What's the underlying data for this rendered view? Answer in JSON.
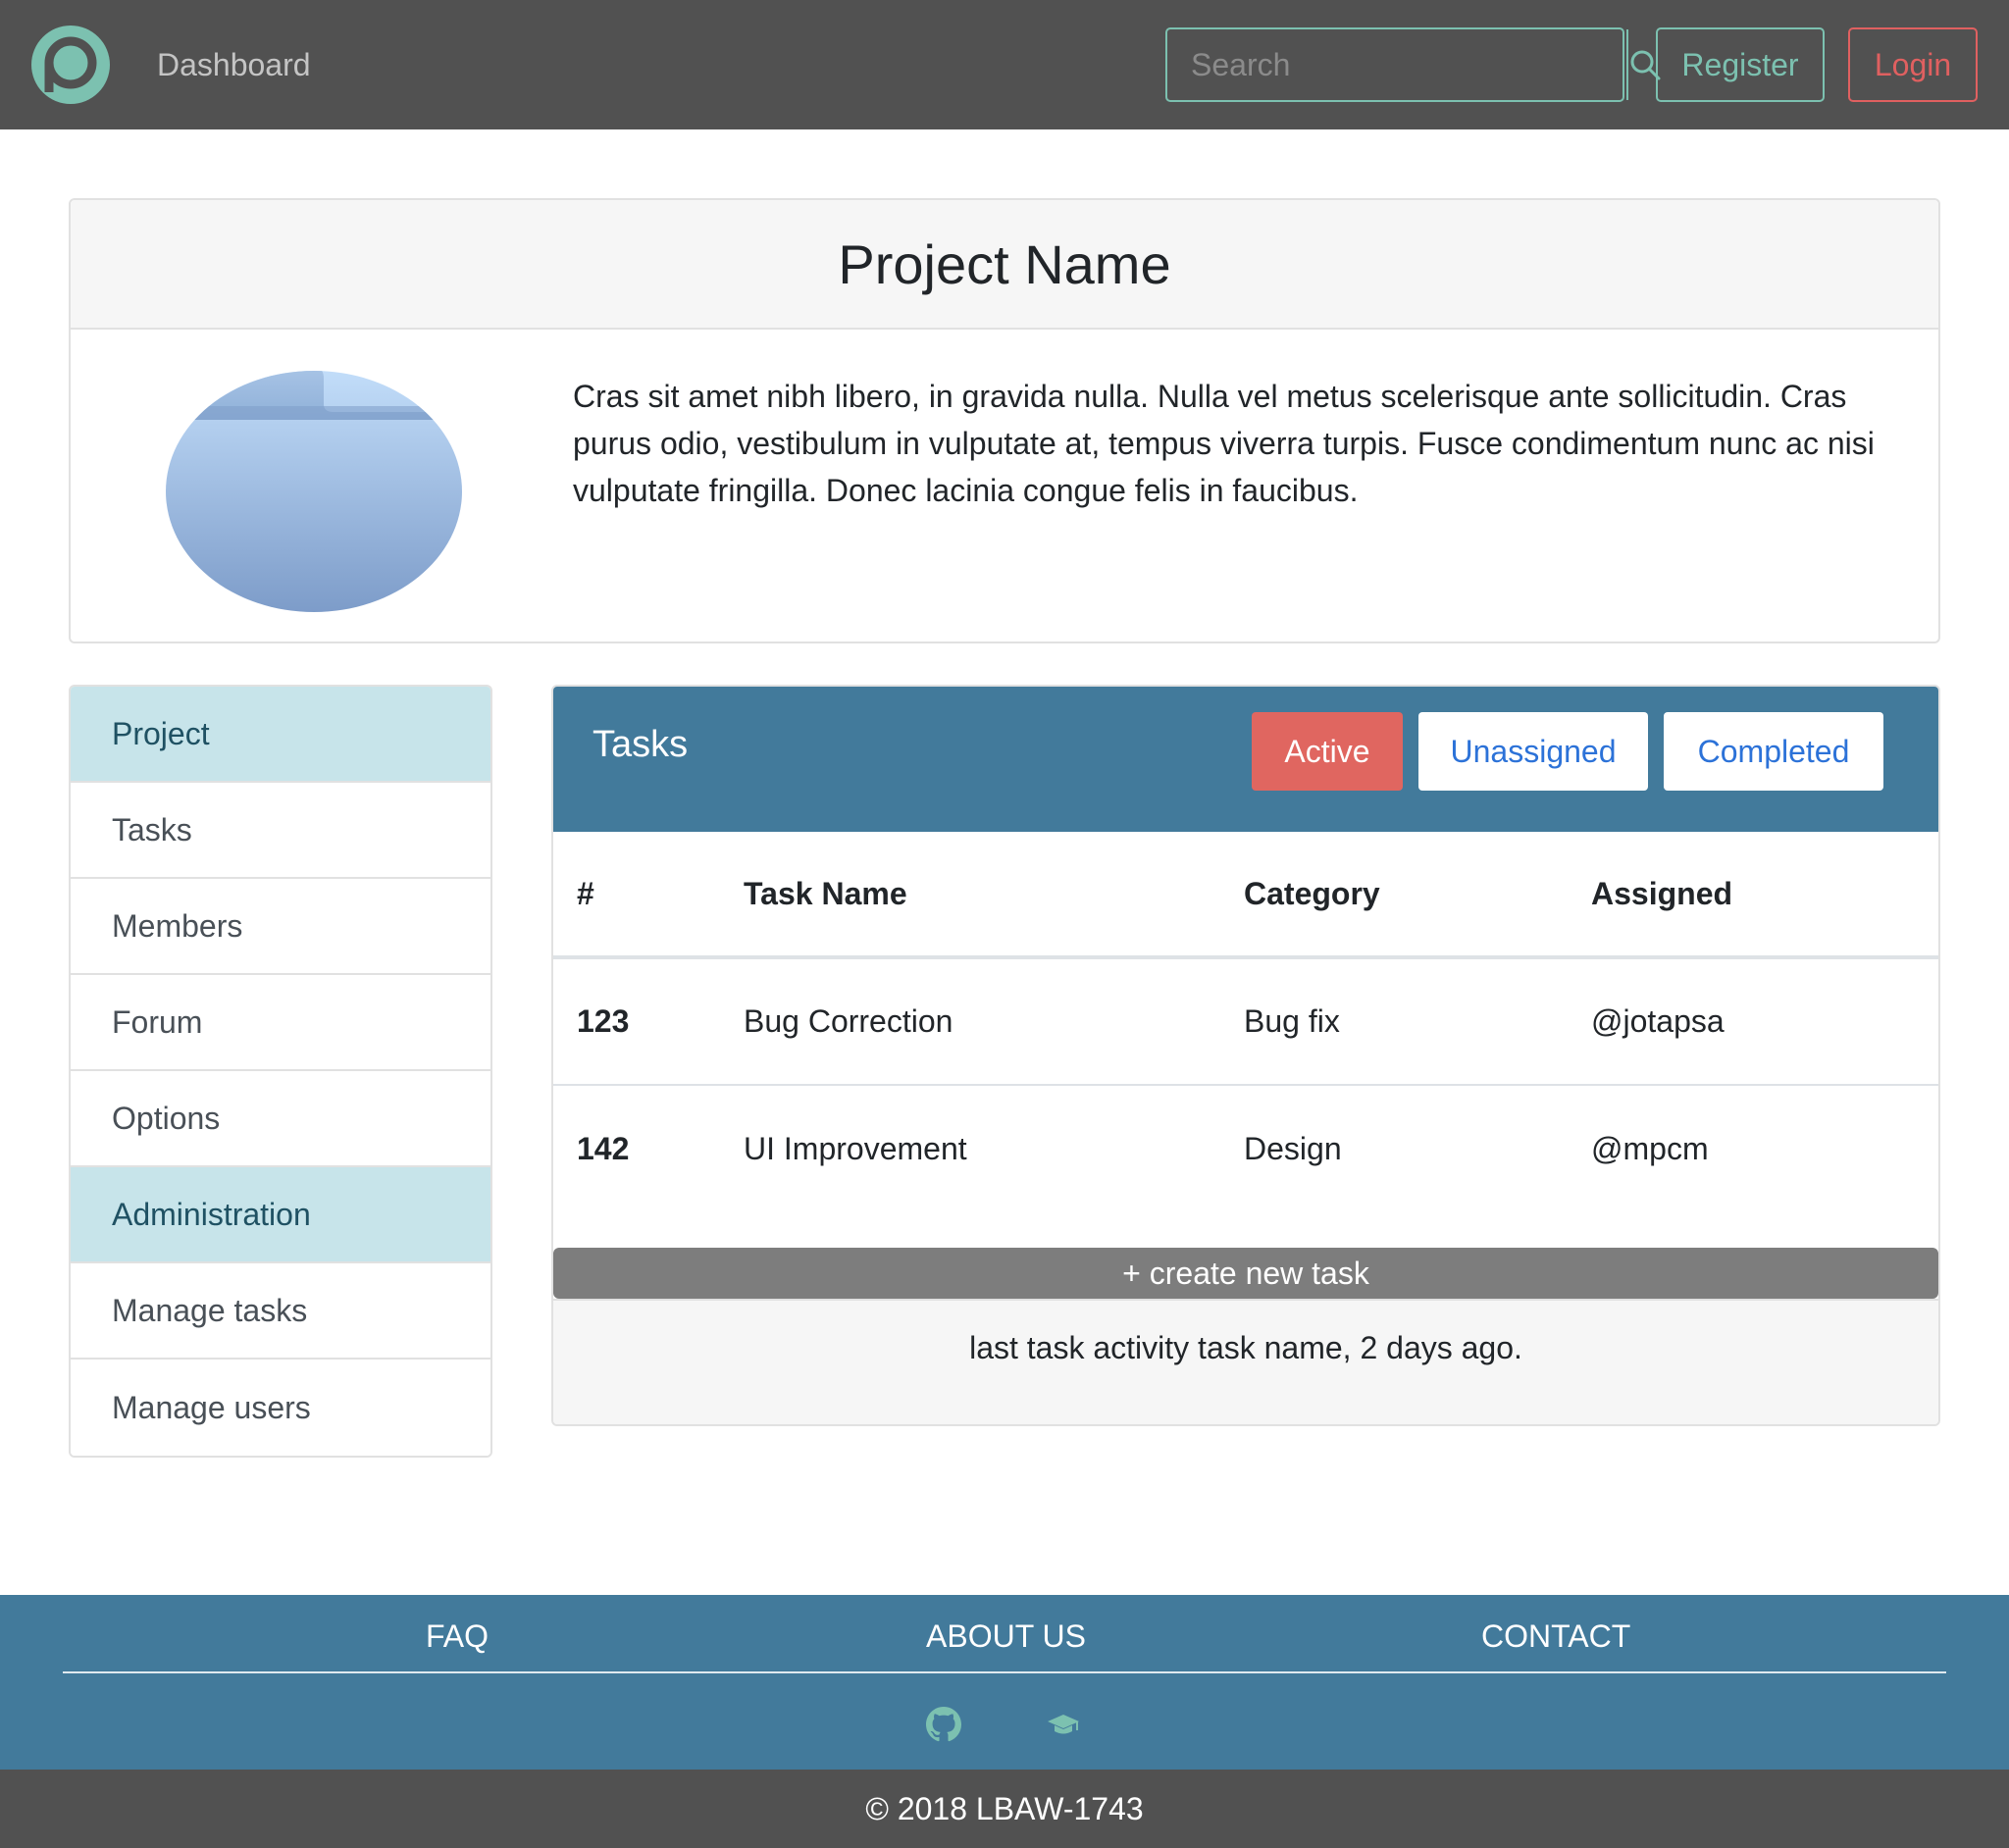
{
  "navbar": {
    "logo_icon": "logo-icon",
    "dashboard_label": "Dashboard",
    "search_placeholder": "Search",
    "search_icon": "search-icon",
    "register_label": "Register",
    "login_label": "Login"
  },
  "project": {
    "title": "Project Name",
    "image_icon": "folder-icon",
    "description": "Cras sit amet nibh libero, in gravida nulla. Nulla vel metus scelerisque ante sollicitudin. Cras purus odio, vestibulum in vulputate at, tempus viverra turpis. Fusce condimentum nunc ac nisi vulputate fringilla. Donec lacinia congue felis in faucibus."
  },
  "sidebar": {
    "items": [
      {
        "label": "Project"
      },
      {
        "label": "Tasks"
      },
      {
        "label": "Members"
      },
      {
        "label": "Forum"
      },
      {
        "label": "Options"
      },
      {
        "label": "Administration"
      },
      {
        "label": "Manage tasks"
      },
      {
        "label": "Manage users"
      }
    ]
  },
  "tasks": {
    "title": "Tasks",
    "filters": {
      "active": "Active",
      "unassigned": "Unassigned",
      "completed": "Completed"
    },
    "columns": [
      "#",
      "Task Name",
      "Category",
      "Assigned"
    ],
    "rows": [
      {
        "num": "123",
        "name": "Bug Correction",
        "category": "Bug fix",
        "assigned": "@jotapsa"
      },
      {
        "num": "142",
        "name": "UI Improvement",
        "category": "Design",
        "assigned": "@mpcm"
      }
    ],
    "create_label": "+ create new task",
    "last_activity": "last task activity task name, 2 days ago."
  },
  "footer": {
    "links": {
      "faq": "FAQ",
      "about": "ABOUT US",
      "contact": "CONTACT"
    },
    "icons": [
      "github-icon",
      "graduation-cap-icon"
    ],
    "copyright": "© 2018 LBAW-1743"
  },
  "colors": {
    "navbar_bg": "#515151",
    "accent_teal": "#7cc1b0",
    "accent_red": "#e06060",
    "panel_blue": "#427a9b",
    "section_highlight": "#c7e4ea",
    "link_blue": "#2c72d8"
  }
}
